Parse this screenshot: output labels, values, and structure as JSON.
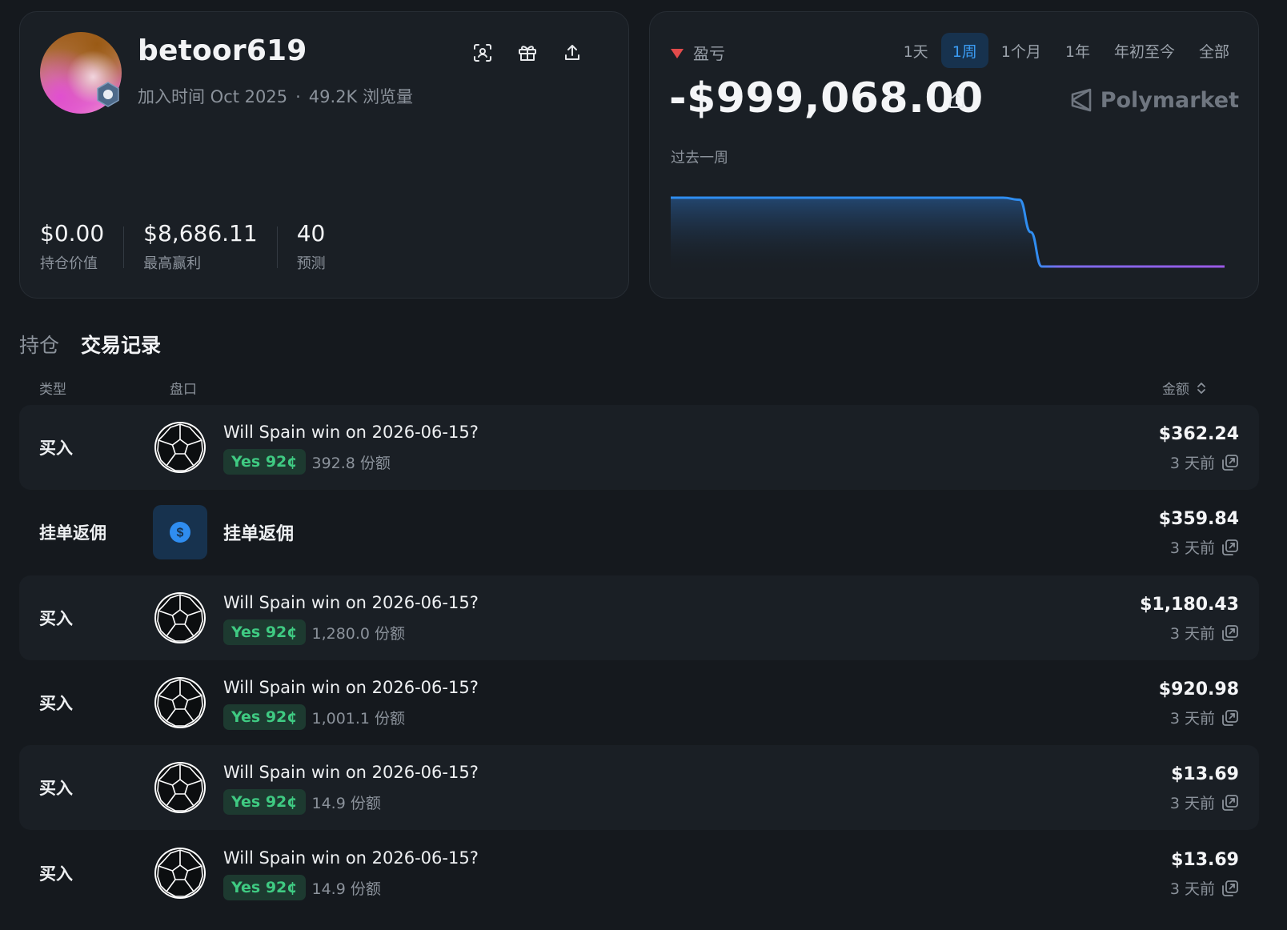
{
  "profile": {
    "username": "betoor619",
    "joined": "加入时间 Oct 2025",
    "dot": "·",
    "views": "49.2K 浏览量",
    "icons": [
      "scan-icon",
      "gift-icon",
      "share-icon"
    ],
    "stats": [
      {
        "value": "$0.00",
        "label": "持仓价值"
      },
      {
        "value": "$8,686.11",
        "label": "最高赢利"
      },
      {
        "value": "40",
        "label": "预测"
      }
    ]
  },
  "pnl": {
    "label": "盈亏",
    "value": "-$999,068.00",
    "period": "过去一周",
    "brand": "Polymarket",
    "ranges": [
      "1天",
      "1周",
      "1个月",
      "1年",
      "年初至今",
      "全部"
    ],
    "active_range": "1周",
    "colors": {
      "line_start": "#2f8df0",
      "line_end": "#9b59e6",
      "negative": "#e24b4b"
    }
  },
  "chart_data": {
    "type": "area",
    "title": "",
    "xlabel": "",
    "ylabel": "",
    "x": [
      0,
      10,
      20,
      30,
      40,
      50,
      60,
      63,
      65,
      67,
      70,
      80,
      90,
      100
    ],
    "y": [
      1,
      1,
      1,
      1,
      1,
      1,
      1,
      0.97,
      0.5,
      0,
      0,
      0,
      0,
      0
    ],
    "grid": false,
    "legend": "none"
  },
  "tabs": [
    {
      "label": "持仓",
      "active": false
    },
    {
      "label": "交易记录",
      "active": true
    }
  ],
  "table": {
    "headers": {
      "type": "类型",
      "market": "盘口",
      "amount": "金额"
    },
    "rows": [
      {
        "type": "买入",
        "kind": "trade",
        "title": "Will Spain win on 2026-06-15?",
        "outcome": "Yes 92¢",
        "shares": "392.8 份额",
        "amount": "$362.24",
        "time": "3 天前"
      },
      {
        "type": "挂单返佣",
        "kind": "rebate",
        "title": "挂单返佣",
        "outcome": "",
        "shares": "",
        "amount": "$359.84",
        "time": "3 天前"
      },
      {
        "type": "买入",
        "kind": "trade",
        "title": "Will Spain win on 2026-06-15?",
        "outcome": "Yes 92¢",
        "shares": "1,280.0 份额",
        "amount": "$1,180.43",
        "time": "3 天前"
      },
      {
        "type": "买入",
        "kind": "trade",
        "title": "Will Spain win on 2026-06-15?",
        "outcome": "Yes 92¢",
        "shares": "1,001.1 份额",
        "amount": "$920.98",
        "time": "3 天前"
      },
      {
        "type": "买入",
        "kind": "trade",
        "title": "Will Spain win on 2026-06-15?",
        "outcome": "Yes 92¢",
        "shares": "14.9 份额",
        "amount": "$13.69",
        "time": "3 天前"
      },
      {
        "type": "买入",
        "kind": "trade",
        "title": "Will Spain win on 2026-06-15?",
        "outcome": "Yes 92¢",
        "shares": "14.9 份额",
        "amount": "$13.69",
        "time": "3 天前"
      }
    ]
  }
}
